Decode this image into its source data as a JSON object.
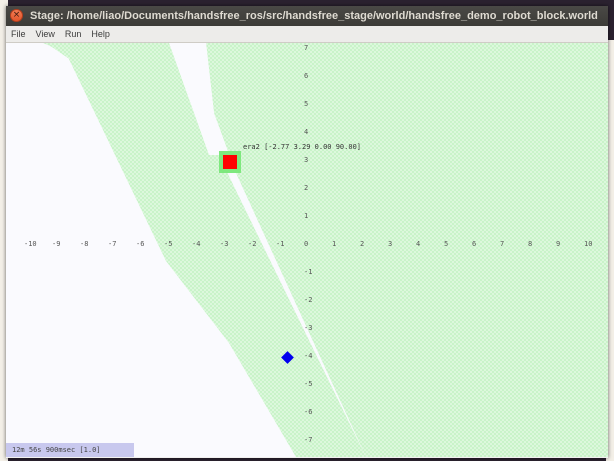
{
  "window": {
    "title": "Stage: /home/liao/Documents/handsfree_ros/src/handsfree_stage/world/handsfree_demo_robot_block.world",
    "close_glyph": "×"
  },
  "menu": [
    {
      "label": "File"
    },
    {
      "label": "View"
    },
    {
      "label": "Run"
    },
    {
      "label": "Help"
    }
  ],
  "x_ticks": [
    "-10",
    "-9",
    "-8",
    "-7",
    "-6",
    "-5",
    "-4",
    "-3",
    "-2",
    "-1",
    "0",
    "1",
    "2",
    "3",
    "4",
    "5",
    "6",
    "7",
    "8",
    "9",
    "10"
  ],
  "y_ticks": [
    "7",
    "6",
    "5",
    "4",
    "3",
    "2",
    "1",
    "-1",
    "-2",
    "-3",
    "-4",
    "-5",
    "-6",
    "-7"
  ],
  "robot": {
    "label": "era2 [-2.77 3.29 0.00 90.00]",
    "body_color": "#ff0000",
    "outline_color": "#7ee87e"
  },
  "target": {
    "color": "#0000ee"
  },
  "laser_color": "#ccf5cc",
  "status": {
    "text": "12m 56s 900msec [1.0]"
  }
}
